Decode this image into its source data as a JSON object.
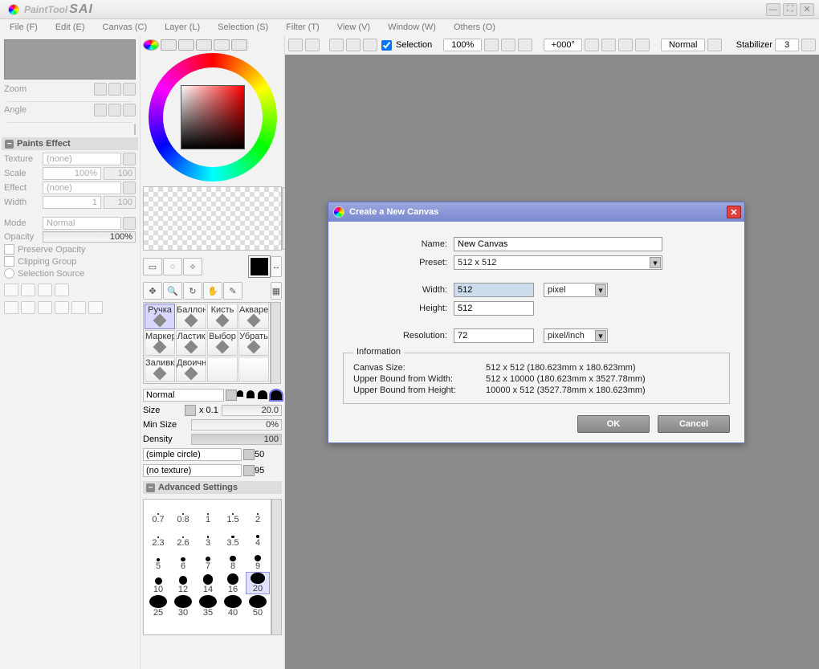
{
  "app": {
    "title1": "PaintTool",
    "title2": "SAI"
  },
  "menu": [
    "File (F)",
    "Edit (E)",
    "Canvas (C)",
    "Layer (L)",
    "Selection (S)",
    "Filter (T)",
    "View (V)",
    "Window (W)",
    "Others (O)"
  ],
  "left": {
    "zoom_label": "Zoom",
    "angle_label": "Angle",
    "paints_effect_header": "Paints Effect",
    "texture_label": "Texture",
    "texture_value": "(none)",
    "scale_label": "Scale",
    "scale_value": "100%",
    "scale_num": "100",
    "effect_label": "Effect",
    "effect_value": "(none)",
    "width_label": "Width",
    "width_value": "1",
    "width_num": "100",
    "mode_label": "Mode",
    "mode_value": "Normal",
    "opacity_label": "Opacity",
    "opacity_value": "100%",
    "preserve": "Preserve Opacity",
    "clipping": "Clipping Group",
    "selsrc": "Selection Source"
  },
  "mid": {
    "tools": [
      "Ручка",
      "Баллонч",
      "Кисть",
      "Акварел",
      "Маркер",
      "Ластик",
      "Выбор",
      "Убрать",
      "Заливка",
      "Двоичн"
    ],
    "blend": "Normal",
    "size_lab": "Size",
    "size_mul": "x 0.1",
    "size_val": "20.0",
    "minsize_lab": "Min Size",
    "minsize_val": "0%",
    "density_lab": "Density",
    "density_val": "100",
    "shape": "(simple circle)",
    "shape_val": "50",
    "texture": "(no texture)",
    "texture_val": "95",
    "adv": "Advanced Settings",
    "brush_sizes": [
      0.7,
      0.8,
      1,
      1.5,
      2,
      2.3,
      2.6,
      3,
      3.5,
      4,
      5,
      6,
      7,
      8,
      9,
      10,
      12,
      14,
      16,
      20,
      25,
      30,
      35,
      40,
      50
    ]
  },
  "toolbar2": {
    "selection": "Selection",
    "zoom": "100%",
    "angle": "+000°",
    "blend": "Normal",
    "stab_lab": "Stabilizer",
    "stab_val": "3"
  },
  "dialog": {
    "title": "Create a New Canvas",
    "name_lab": "Name:",
    "name_val": "New Canvas",
    "preset_lab": "Preset:",
    "preset_val": "512 x  512",
    "width_lab": "Width:",
    "width_val": "512",
    "height_lab": "Height:",
    "height_val": "512",
    "unit": "pixel",
    "res_lab": "Resolution:",
    "res_val": "72",
    "res_unit": "pixel/inch",
    "info_header": "Information",
    "canvas_size_lab": "Canvas Size:",
    "canvas_size_val": "512 x 512 (180.623mm x 180.623mm)",
    "ubw_lab": "Upper Bound from Width:",
    "ubw_val": "512 x 10000 (180.623mm x 3527.78mm)",
    "ubh_lab": "Upper Bound from Height:",
    "ubh_val": "10000 x 512 (3527.78mm x 180.623mm)",
    "ok": "OK",
    "cancel": "Cancel"
  }
}
